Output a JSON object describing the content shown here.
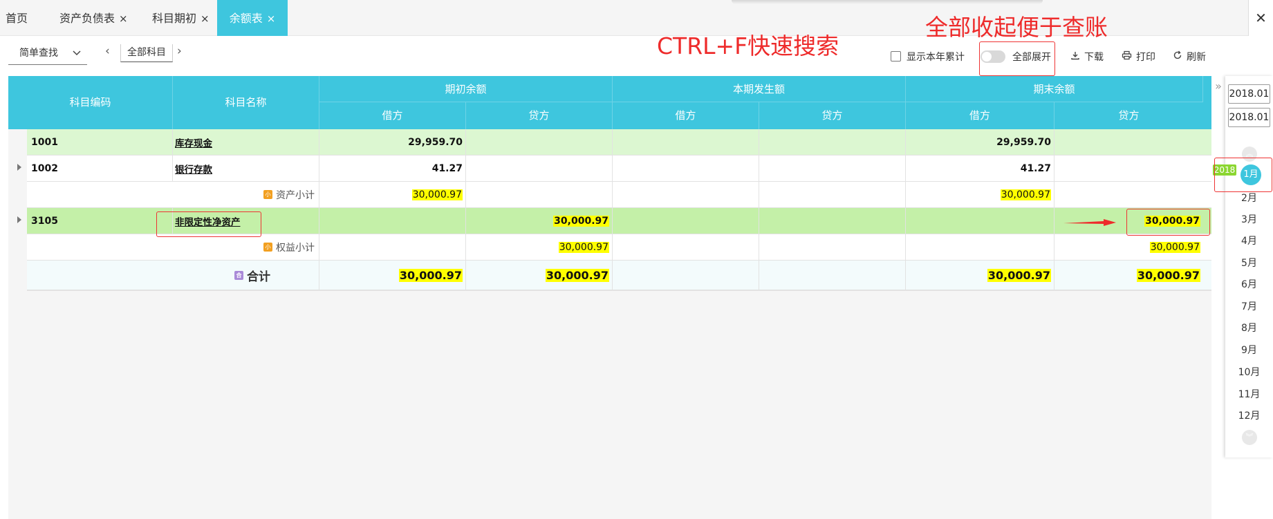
{
  "tabs": [
    {
      "label": "首页",
      "closable": false
    },
    {
      "label": "资产负债表",
      "closable": true
    },
    {
      "label": "科目期初",
      "closable": true
    },
    {
      "label": "余额表",
      "closable": true,
      "active": true
    }
  ],
  "tab_close_glyph": "×",
  "window_close_glyph": "✕",
  "toolbar": {
    "simple_search": "简单查找",
    "prev_glyph": "‹",
    "next_glyph": "›",
    "all_subjects": "全部科目",
    "show_year_total": "显示本年累计",
    "expand_all": "全部展开",
    "download": "下载",
    "print": "打印",
    "refresh": "刷新"
  },
  "annotations": {
    "search_tip": "CTRL+F快速搜索",
    "collapse_tip": "全部收起便于查账"
  },
  "table": {
    "headers": {
      "code": "科目编码",
      "name": "科目名称",
      "opening": "期初余额",
      "period": "本期发生额",
      "closing": "期末余额",
      "debit": "借方",
      "credit": "贷方"
    },
    "rows": [
      {
        "code": "1001",
        "name": "库存现金",
        "open_debit": "29,959.70",
        "open_credit": "",
        "period_debit": "",
        "period_credit": "",
        "close_debit": "29,959.70",
        "close_credit": ""
      },
      {
        "code": "1002",
        "name": "银行存款",
        "open_debit": "41.27",
        "open_credit": "",
        "period_debit": "",
        "period_credit": "",
        "close_debit": "41.27",
        "close_credit": ""
      },
      {
        "label": "资产小计",
        "open_debit": "30,000.97",
        "open_credit": "",
        "period_debit": "",
        "period_credit": "",
        "close_debit": "30,000.97",
        "close_credit": ""
      },
      {
        "code": "3105",
        "name": "非限定性净资产",
        "open_debit": "",
        "open_credit": "30,000.97",
        "period_debit": "",
        "period_credit": "",
        "close_debit": "",
        "close_credit": "30,000.97"
      },
      {
        "label": "权益小计",
        "open_debit": "",
        "open_credit": "30,000.97",
        "period_debit": "",
        "period_credit": "",
        "close_debit": "",
        "close_credit": "30,000.97"
      },
      {
        "label": "合计",
        "open_debit": "30,000.97",
        "open_credit": "30,000.97",
        "period_debit": "",
        "period_credit": "",
        "close_debit": "30,000.97",
        "close_credit": "30,000.97"
      }
    ]
  },
  "period_panel": {
    "collapse_glyph": "»",
    "start_date": "2018.01",
    "end_date": "2018.01",
    "year_badge": "2018",
    "active_month": "1月",
    "months": [
      "2月",
      "3月",
      "4月",
      "5月",
      "6月",
      "7月",
      "8月",
      "9月",
      "10月",
      "11月",
      "12月"
    ],
    "scroll_up_glyph": "︽",
    "scroll_down_glyph": "︾"
  },
  "colors": {
    "accent": "#3ec6de",
    "annotation_red": "#ee2b2b",
    "highlight_yellow": "#ffff00",
    "row_light_green": "#dcf7d1",
    "row_green": "#c4f0a8",
    "year_badge_green": "#8bd630"
  }
}
